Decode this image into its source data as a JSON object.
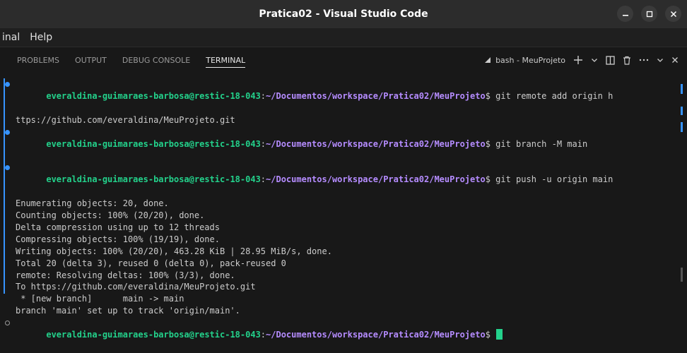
{
  "window": {
    "title": "Pratica02 - Visual Studio Code"
  },
  "menubar": {
    "items": [
      "inal",
      "Help"
    ]
  },
  "panel": {
    "tabs": [
      "PROBLEMS",
      "OUTPUT",
      "DEBUG CONSOLE",
      "TERMINAL"
    ],
    "active_tab": "TERMINAL",
    "terminal_instance": "bash - MeuProjeto"
  },
  "terminal": {
    "user_host": "everaldina-guimaraes-barbosa@restic-18-043",
    "path": "~/Documentos/workspace/Pratica02/MeuProjeto",
    "commands": [
      {
        "cmd": "git remote add origin h",
        "wrap": "ttps://github.com/everaldina/MeuProjeto.git"
      },
      {
        "cmd": "git branch -M main"
      },
      {
        "cmd": "git push -u origin main"
      }
    ],
    "output": [
      "Enumerating objects: 20, done.",
      "Counting objects: 100% (20/20), done.",
      "Delta compression using up to 12 threads",
      "Compressing objects: 100% (19/19), done.",
      "Writing objects: 100% (20/20), 463.28 KiB | 28.95 MiB/s, done.",
      "Total 20 (delta 3), reused 0 (delta 0), pack-reused 0",
      "remote: Resolving deltas: 100% (3/3), done.",
      "To https://github.com/everaldina/MeuProjeto.git",
      " * [new branch]      main -> main",
      "branch 'main' set up to track 'origin/main'."
    ]
  },
  "colors": {
    "user": "#23d18b",
    "path": "#b58cff",
    "accent": "#3794ff"
  }
}
